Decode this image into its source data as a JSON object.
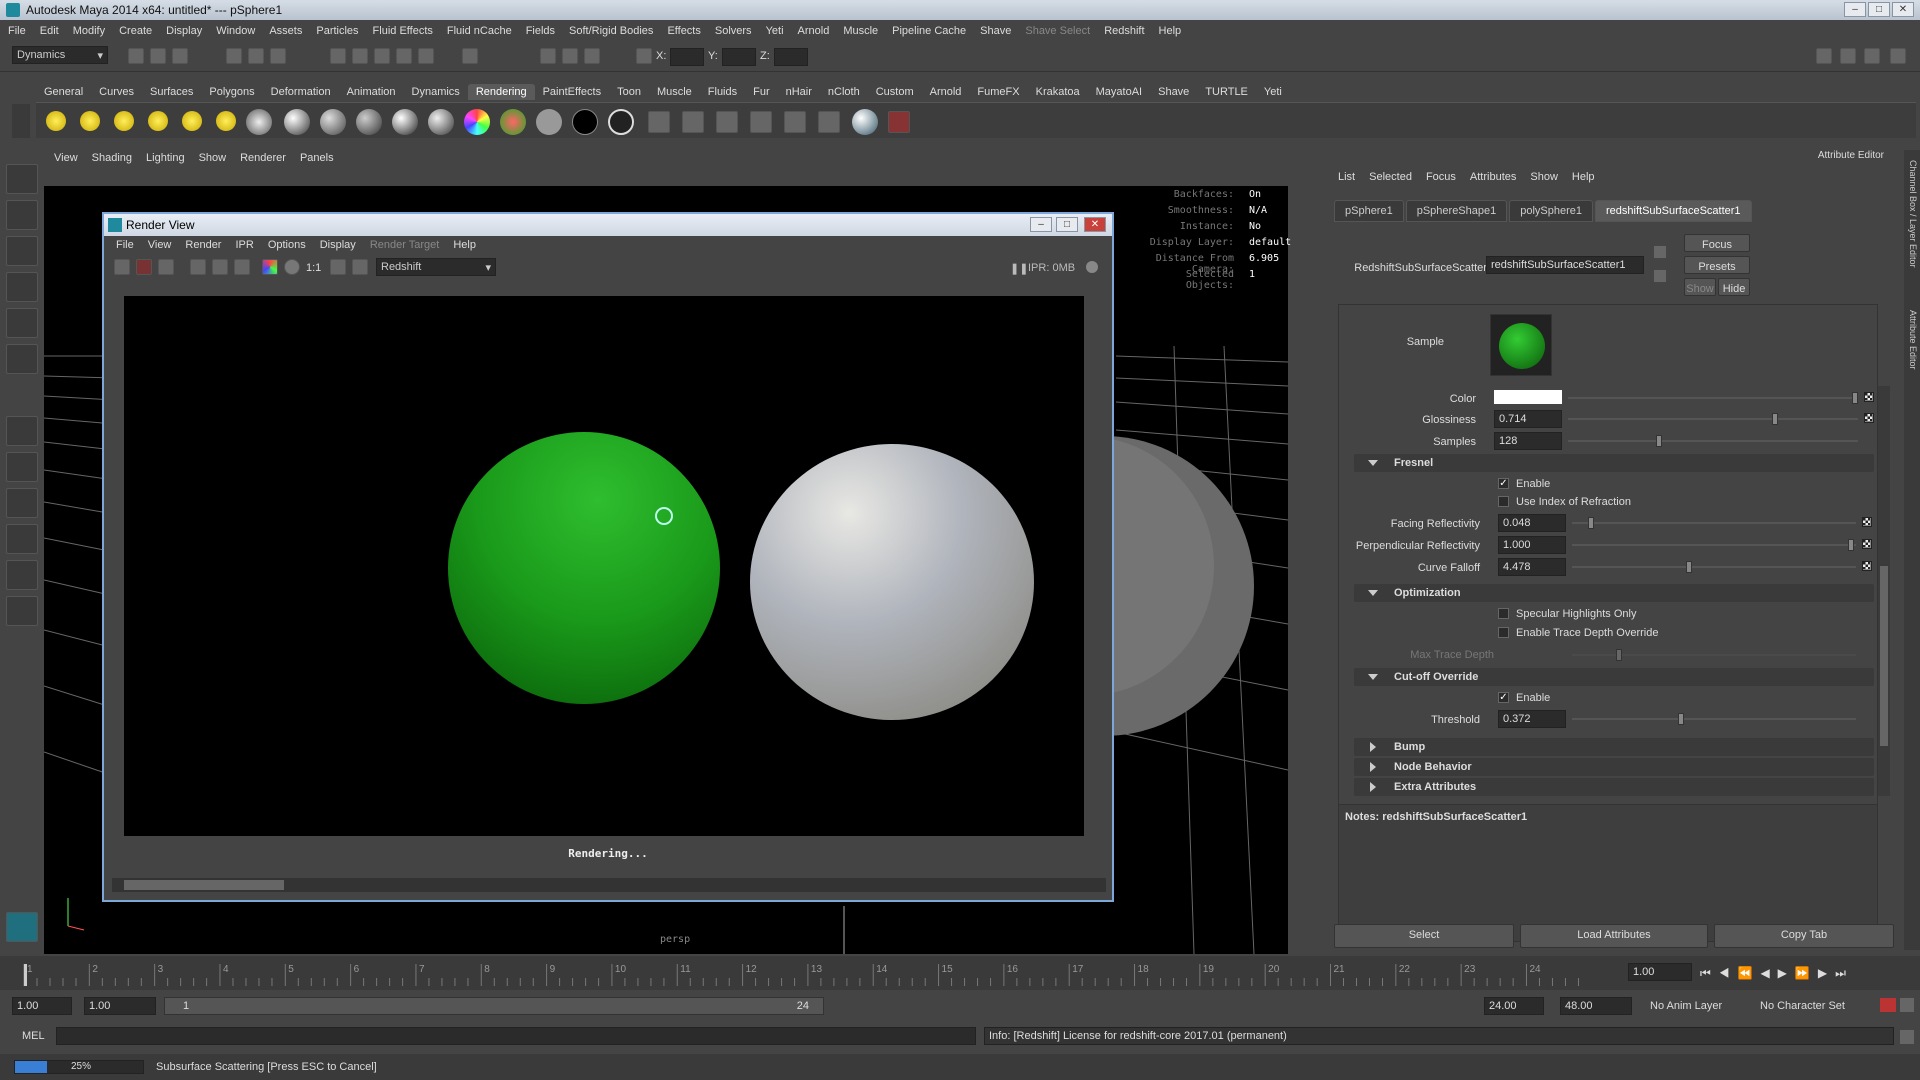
{
  "app": {
    "title": "Autodesk Maya 2014 x64: untitled*   ---   pSphere1",
    "menu": [
      "File",
      "Edit",
      "Modify",
      "Create",
      "Display",
      "Window",
      "Assets",
      "Particles",
      "Fluid Effects",
      "Fluid nCache",
      "Fields",
      "Soft/Rigid Bodies",
      "Effects",
      "Solvers",
      "Yeti",
      "Arnold",
      "Muscle",
      "Pipeline Cache",
      "Shave",
      "Shave Select",
      "Redshift",
      "Help"
    ],
    "menuset": "Dynamics",
    "coord_labels": {
      "x": "X:",
      "y": "Y:",
      "z": "Z:"
    }
  },
  "shelf": {
    "tabs": [
      "General",
      "Curves",
      "Surfaces",
      "Polygons",
      "Deformation",
      "Animation",
      "Dynamics",
      "Rendering",
      "PaintEffects",
      "Toon",
      "Muscle",
      "Fluids",
      "Fur",
      "nHair",
      "nCloth",
      "Custom",
      "Arnold",
      "FumeFX",
      "Krakatoa",
      "MayatoAI",
      "Shave",
      "TURTLE",
      "Yeti"
    ],
    "active_tab": "Rendering"
  },
  "viewport": {
    "menu": [
      "View",
      "Shading",
      "Lighting",
      "Show",
      "Renderer",
      "Panels"
    ],
    "camera_label": "persp",
    "hud": [
      {
        "label": "Backfaces:",
        "value": "On"
      },
      {
        "label": "Smoothness:",
        "value": "N/A"
      },
      {
        "label": "Instance:",
        "value": "No"
      },
      {
        "label": "Display Layer:",
        "value": "default"
      },
      {
        "label": "Distance From Camera:",
        "value": "6.905"
      },
      {
        "label": "Selected Objects:",
        "value": "1"
      }
    ]
  },
  "render_view": {
    "title": "Render View",
    "menu": [
      "File",
      "View",
      "Render",
      "IPR",
      "Options",
      "Display",
      "Render Target",
      "Help"
    ],
    "ratio_label": "1:1",
    "renderer": "Redshift",
    "ipr": "IPR: 0MB",
    "status": "Rendering..."
  },
  "attribute_editor": {
    "title": "Attribute Editor",
    "menu": [
      "List",
      "Selected",
      "Focus",
      "Attributes",
      "Show",
      "Help"
    ],
    "tabs": [
      "pSphere1",
      "pSphereShape1",
      "polySphere1",
      "redshiftSubSurfaceScatter1"
    ],
    "active_tab": "redshiftSubSurfaceScatter1",
    "node_label": "RedshiftSubSurfaceScatter:",
    "node_name": "redshiftSubSurfaceScatter1",
    "buttons": {
      "focus": "Focus",
      "presets": "Presets",
      "show": "Show",
      "hide": "Hide"
    },
    "sample_label": "Sample",
    "sample_color": "#1e8a1e",
    "color_label": "Color",
    "color_value": "#ffffff",
    "glossiness_label": "Glossiness",
    "glossiness": "0.714",
    "samples_label": "Samples",
    "samples": "128",
    "fresnel": {
      "title": "Fresnel",
      "enable": "Enable",
      "use_ior": "Use Index of Refraction",
      "facing_label": "Facing Reflectivity",
      "facing": "0.048",
      "perp_label": "Perpendicular Reflectivity",
      "perp": "1.000",
      "curve_label": "Curve Falloff",
      "curve": "4.478"
    },
    "optimization": {
      "title": "Optimization",
      "spec_only": "Specular Highlights Only",
      "trace_override": "Enable Trace Depth Override",
      "max_trace": "Max Trace Depth"
    },
    "cutoff": {
      "title": "Cut-off Override",
      "enable": "Enable",
      "threshold_label": "Threshold",
      "threshold": "0.372"
    },
    "collapsed": [
      "Bump",
      "Node Behavior",
      "Extra Attributes"
    ],
    "notes": "Notes:  redshiftSubSurfaceScatter1",
    "bottom_buttons": [
      "Select",
      "Load Attributes",
      "Copy Tab"
    ],
    "side_tabs": [
      "Channel Box / Layer Editor",
      "Attribute Editor"
    ]
  },
  "timeline": {
    "ticks": [
      "1",
      "2",
      "3",
      "4",
      "5",
      "6",
      "7",
      "8",
      "9",
      "10",
      "11",
      "12",
      "13",
      "14",
      "15",
      "16",
      "17",
      "18",
      "19",
      "20",
      "21",
      "22",
      "23",
      "24"
    ],
    "current_frame": "1.00",
    "range_start": "1.00",
    "range_start2": "1.00",
    "range_inner_start": "1",
    "range_inner_end": "24",
    "range_end": "24.00",
    "range_end2": "48.00",
    "anim_layer": "No Anim Layer",
    "char_set": "No Character Set"
  },
  "cmdline": {
    "label": "MEL",
    "output": "Info:  [Redshift] License for redshift-core 2017.01 (permanent)"
  },
  "helpline": {
    "progress_label": "25%",
    "progress": 0.25,
    "message": "Subsurface Scattering [Press ESC to Cancel]"
  }
}
